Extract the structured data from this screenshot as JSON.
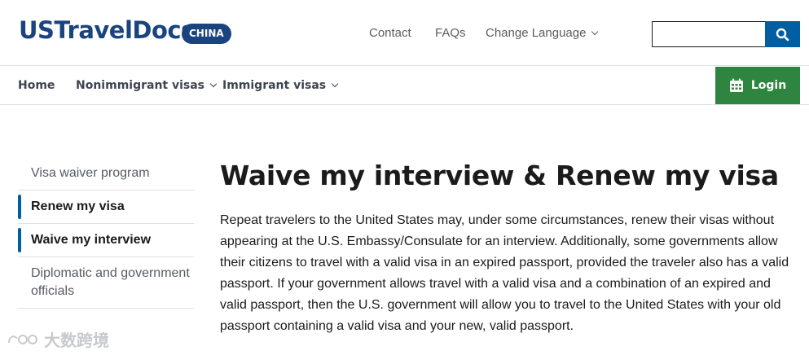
{
  "header": {
    "logo": "USTravelDocs",
    "country_badge": "CHINA",
    "links": {
      "contact": "Contact",
      "faqs": "FAQs",
      "change_language": "Change Language"
    },
    "search": {
      "value": "",
      "placeholder": ""
    }
  },
  "nav": {
    "home": "Home",
    "nonimmigrant": "Nonimmigrant visas",
    "immigrant": "Immigrant visas",
    "login": "Login"
  },
  "sidebar": {
    "items": [
      {
        "label": "Visa waiver program",
        "active": false
      },
      {
        "label": "Renew my visa",
        "active": true
      },
      {
        "label": "Waive my interview",
        "active": true
      },
      {
        "label": "Diplomatic and government officials",
        "active": false
      }
    ]
  },
  "main": {
    "title": "Waive my interview & Renew my visa",
    "paragraph": "Repeat travelers to the United States may, under some circumstances, renew their visas without appearing at the U.S. Embassy/Consulate for an interview. Additionally, some governments allow their citizens to travel with a valid visa in an expired passport, provided the traveler also has a valid passport. If your government allows travel with a valid visa and a combination of an expired and valid passport, then the U.S. government will allow you to travel to the United States with your old passport containing a valid visa and your new, valid passport."
  },
  "watermark": {
    "text": "大数跨境"
  },
  "colors": {
    "brand": "#1a4480",
    "search_button": "#005ea2",
    "login": "#2e8540",
    "active_marker": "#005ea2"
  },
  "icons": {
    "search": "search-icon",
    "calendar": "calendar-icon",
    "chevron": "chevron-down-icon"
  }
}
